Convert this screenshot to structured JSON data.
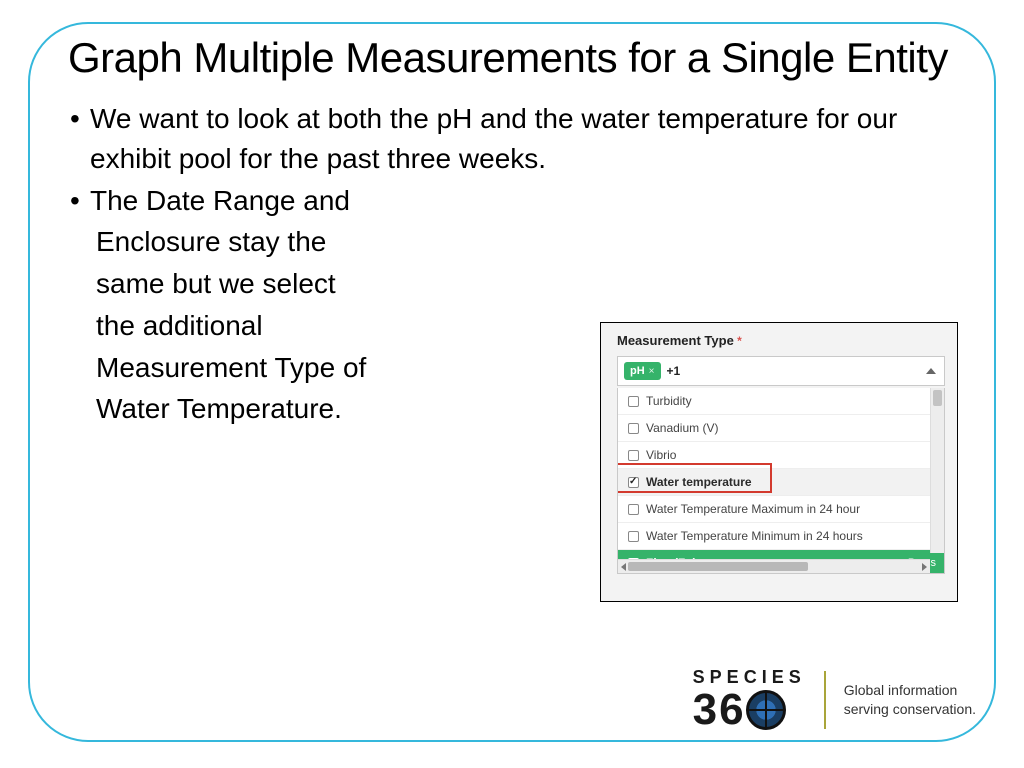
{
  "title": "Graph Multiple Measurements for a Single Entity",
  "bullets": {
    "b1": "We want to look at both the pH and the water temperature for our exhibit pool for the past three weeks.",
    "b2": "The Date Range and",
    "b2_lines": {
      "l1": "Enclosure stay the",
      "l2": "same but we select",
      "l3": "the additional",
      "l4": "Measurement Type of",
      "l5": "Water Temperature."
    }
  },
  "panel": {
    "label": "Measurement Type",
    "chip": "pH",
    "plus": "+1",
    "options": {
      "o1": "Turbidity",
      "o2": "Vanadium (V)",
      "o3": "Vibrio",
      "o4": "Water temperature",
      "o5": "Water Temperature Maximum in 24 hour",
      "o6": "Water Temperature Minimum in 24 hours",
      "o7": "Zinc (Zn)",
      "press": "Press"
    }
  },
  "brand": {
    "species": "SPECIES",
    "three": "3",
    "six": "6",
    "tag1": "Global information",
    "tag2": "serving conservation."
  }
}
